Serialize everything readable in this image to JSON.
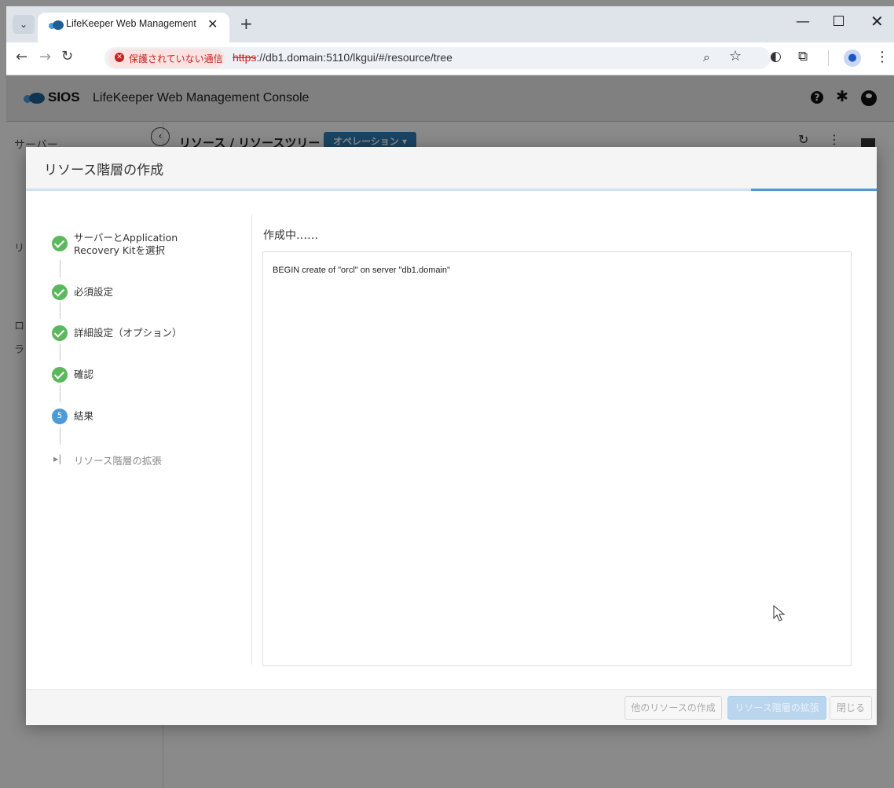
{
  "browser": {
    "tab_title": "LifeKeeper Web Management C",
    "new_tab": "+",
    "security_label": "保護されていない通信",
    "url_scheme": "https",
    "url_rest": "://db1.domain:5110/lkgui/#/resource/tree"
  },
  "app": {
    "brand": "SIOS",
    "title": "LifeKeeper Web Management Console"
  },
  "page": {
    "sidebar_title": "サーバー",
    "sidebar_r": "リ",
    "sidebar_ro": "ロ",
    "sidebar_ra": "ラ",
    "breadcrumb": "リソース / リソースツリー",
    "operations_label": "オペレーション ▾"
  },
  "modal": {
    "title": "リソース階層の作成",
    "steps": [
      {
        "label": "サーバーとApplication Recovery Kitを選択",
        "state": "done"
      },
      {
        "label": "必須設定",
        "state": "done"
      },
      {
        "label": "詳細設定（オプション）",
        "state": "done"
      },
      {
        "label": "確認",
        "state": "done"
      },
      {
        "label": "結果",
        "state": "current",
        "number": "5"
      },
      {
        "label": "リソース階層の拡張",
        "state": "skipped"
      }
    ],
    "status": "作成中……",
    "log": "BEGIN create of \"orcl\" on server \"db1.domain\"",
    "buttons": {
      "create_other": "他のリソースの作成",
      "extend": "リソース階層の拡張",
      "close": "閉じる"
    }
  },
  "colors": {
    "primary": "#4a9bd8",
    "success": "#5cb85c",
    "danger": "#c5221f"
  }
}
